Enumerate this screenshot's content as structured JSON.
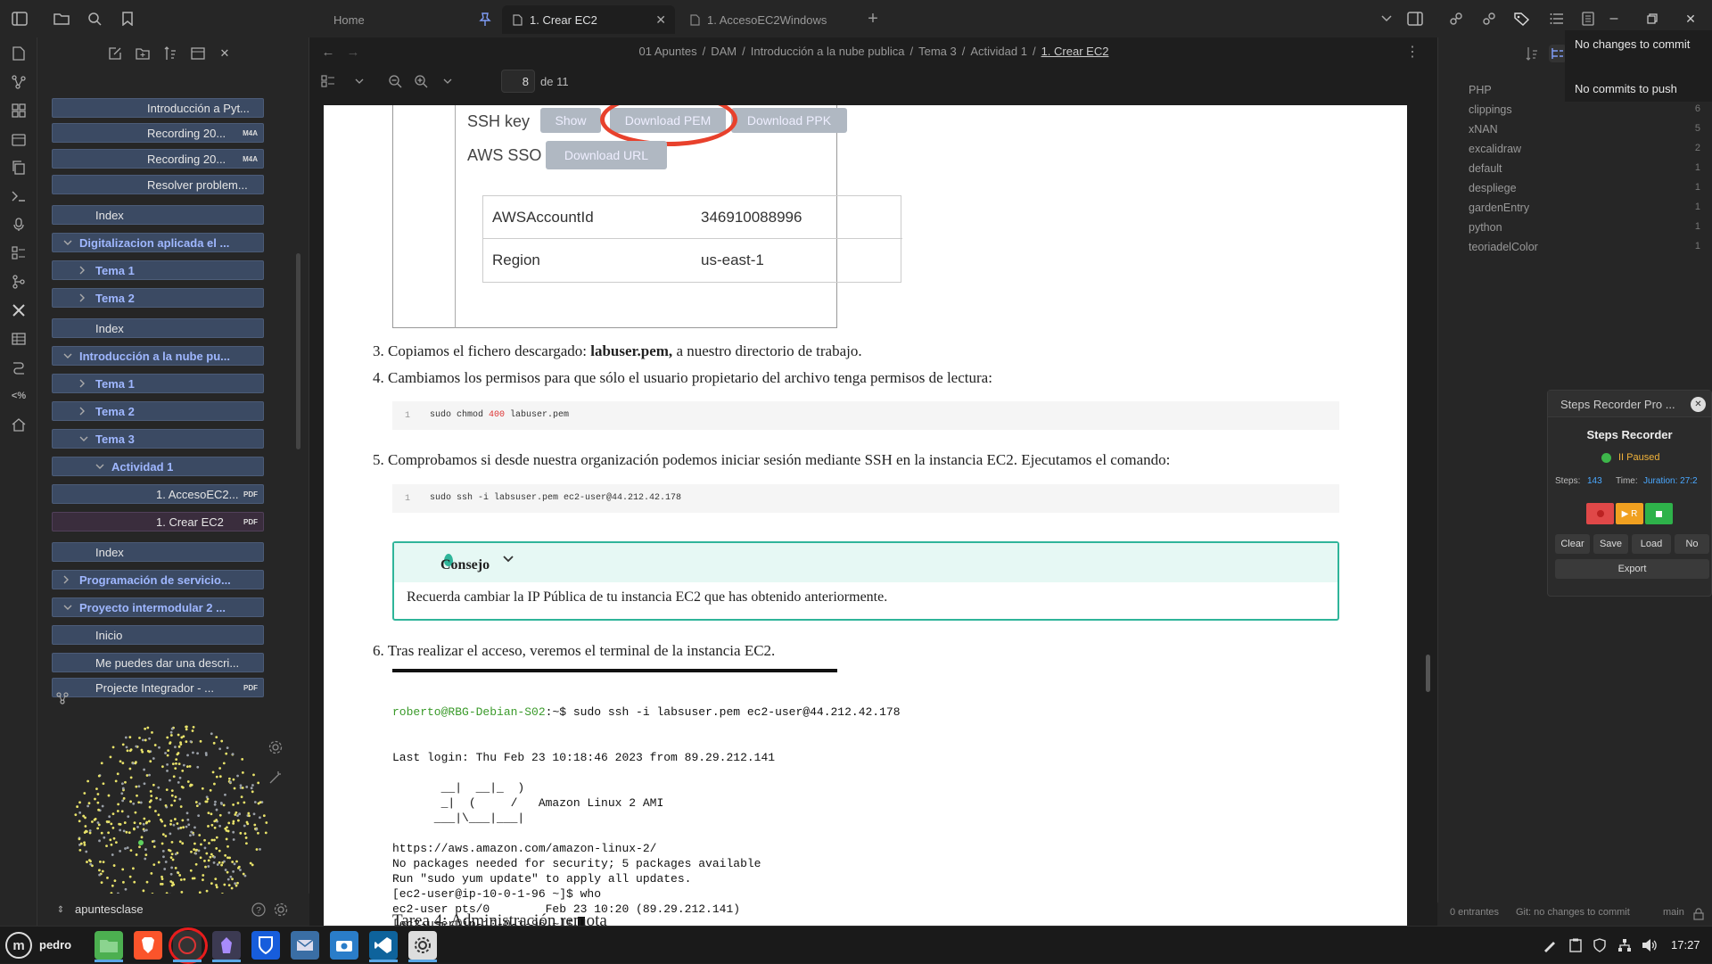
{
  "tabs": [
    {
      "label": "Home"
    },
    {
      "label": "1. Crear EC2"
    },
    {
      "label": "1. AccesoEC2Windows"
    }
  ],
  "breadcrumb": [
    "01 Apuntes",
    "DAM",
    "Introducción a la nube publica",
    "Tema 3",
    "Actividad 1",
    "1. Crear EC2"
  ],
  "pdf_toolbar": {
    "page": "8",
    "of_label": "de 11"
  },
  "sidebar": {
    "items": [
      {
        "label": "Introducción a Pyt...",
        "indent": 4,
        "badge": ""
      },
      {
        "label": "Recording 20...",
        "indent": 4,
        "badge": "M4A"
      },
      {
        "label": "Recording 20...",
        "indent": 4,
        "badge": "M4A"
      },
      {
        "label": "Resolver problem...",
        "indent": 4,
        "badge": ""
      },
      {
        "label": "Index",
        "indent": 3,
        "badge": ""
      },
      {
        "label": "Digitalizacion aplicada el ...",
        "indent": 2,
        "badge": "",
        "bold": true,
        "chev": "open"
      },
      {
        "label": "Tema 1",
        "indent": 3,
        "badge": "",
        "bold": true,
        "chev": "closed"
      },
      {
        "label": "Tema 2",
        "indent": 3,
        "badge": "",
        "bold": true,
        "chev": "closed"
      },
      {
        "label": "Index",
        "indent": 3,
        "badge": ""
      },
      {
        "label": "Introducción a la nube pu...",
        "indent": 2,
        "badge": "",
        "bold": true,
        "chev": "open"
      },
      {
        "label": "Tema 1",
        "indent": 3,
        "badge": "",
        "bold": true,
        "chev": "closed"
      },
      {
        "label": "Tema 2",
        "indent": 3,
        "badge": "",
        "bold": true,
        "chev": "closed"
      },
      {
        "label": "Tema 3",
        "indent": 3,
        "badge": "",
        "bold": true,
        "chev": "open"
      },
      {
        "label": "Actividad 1",
        "indent": 4,
        "badge": "",
        "bold": true,
        "chev": "open"
      },
      {
        "label": "1. AccesoEC2...",
        "indent": 5,
        "badge": "PDF"
      },
      {
        "label": "1. Crear EC2",
        "indent": 5,
        "badge": "PDF",
        "selected": true
      },
      {
        "label": "Index",
        "indent": 3,
        "badge": ""
      },
      {
        "label": "Programación de servicio...",
        "indent": 2,
        "badge": "",
        "bold": true,
        "chev": "closed"
      },
      {
        "label": "Proyecto intermodular 2 ...",
        "indent": 2,
        "badge": "",
        "bold": true,
        "chev": "open"
      },
      {
        "label": "Inicio",
        "indent": 3,
        "badge": ""
      },
      {
        "label": "Me puedes dar una descri...",
        "indent": 3,
        "badge": ""
      },
      {
        "label": "Projecte Integrador - ...",
        "indent": 3,
        "badge": "PDF"
      }
    ],
    "vault_name": "apuntesclase"
  },
  "pdf": {
    "ssh_key_label": "SSH key",
    "aws_sso_label": "AWS SSO",
    "btn_show": "Show",
    "btn_download_pem": "Download PEM",
    "btn_download_ppk": "Download PPK",
    "btn_download_url": "Download URL",
    "account_rows": [
      {
        "key": "AWSAccountId",
        "value": "346910088996"
      },
      {
        "key": "Region",
        "value": "us-east-1"
      }
    ],
    "step3": {
      "num": "3.",
      "pre": "Copiamos el fichero descargado: ",
      "bold": "labuser.pem,",
      "post": " a nuestro directorio de trabajo."
    },
    "step4": {
      "num": "4.",
      "text": "Cambiamos los permisos para que sólo el usuario propietario del archivo tenga permisos de lectura:"
    },
    "code1": {
      "line": "1",
      "pre": "sudo chmod ",
      "num": "400",
      "post": " labuser.pem"
    },
    "step5": {
      "num": "5.",
      "text": "Comprobamos si desde nuestra organización podemos iniciar sesión mediante SSH en la instancia EC2. Ejecutamos el comando:"
    },
    "code2": {
      "line": "1",
      "text": "sudo ssh -i labsuser.pem ec2-user@44.212.42.178"
    },
    "callout": {
      "title": "Consejo",
      "text": "Recuerda cambiar la IP Pública de tu instancia EC2 que has obtenido anteriormente."
    },
    "step6": {
      "num": "6.",
      "text": "Tras realizar el acceso, veremos el terminal de la instancia EC2."
    },
    "terminal": {
      "prompt_user": "roberto@RBG-Debian-S02",
      "prompt_rest": ":~$ sudo ssh -i labsuser.pem ec2-user@44.212.42.178",
      "lines": [
        "Last login: Thu Feb 23 10:18:46 2023 from 89.29.212.141",
        "",
        "       __|  __|_  )",
        "       _|  (     /   Amazon Linux 2 AMI",
        "      ___|\\___|___|",
        "",
        "https://aws.amazon.com/amazon-linux-2/",
        "No packages needed for security; 5 packages available",
        "Run \"sudo yum update\" to apply all updates.",
        "[ec2-user@ip-10-0-1-96 ~]$ who",
        "ec2-user pts/0        Feb 23 10:20 (89.29.212.141)",
        "[ec2-user@ip-10-0-1-96 ~]$ "
      ]
    },
    "next_heading": "Tarea 4: Administración remota"
  },
  "git_popup": {
    "line1": "No changes to commit",
    "line2": "No commits to push"
  },
  "tags": [
    {
      "name": "PHP",
      "count": ""
    },
    {
      "name": "clippings",
      "count": "6"
    },
    {
      "name": "xNAN",
      "count": "5"
    },
    {
      "name": "excalidraw",
      "count": "2"
    },
    {
      "name": "default",
      "count": "1"
    },
    {
      "name": "despliege",
      "count": "1"
    },
    {
      "name": "gardenEntry",
      "count": "1"
    },
    {
      "name": "python",
      "count": "1"
    },
    {
      "name": "teoriadelColor",
      "count": "1"
    }
  ],
  "steps_recorder": {
    "window_title": "Steps Recorder Pro ...",
    "title": "Steps Recorder",
    "status": "II Paused",
    "steps_label": "Steps:",
    "steps_value": "143",
    "time_label": "Time:",
    "time_value": "Juration: 27:2",
    "btn_r": "▶ R",
    "buttons": [
      "Clear",
      "Save",
      "Load",
      "No"
    ],
    "export": "Export"
  },
  "statusbar": {
    "entrantes": "0 entrantes",
    "git": "Git: no changes to commit",
    "branch": "main"
  },
  "taskbar": {
    "user": "pedro",
    "clock": "17:27"
  },
  "colors": {
    "accent": "#7f6df2",
    "callout": "#2fb59a",
    "red_circle": "#e8412c",
    "tree_bg": "#3b4a63"
  }
}
